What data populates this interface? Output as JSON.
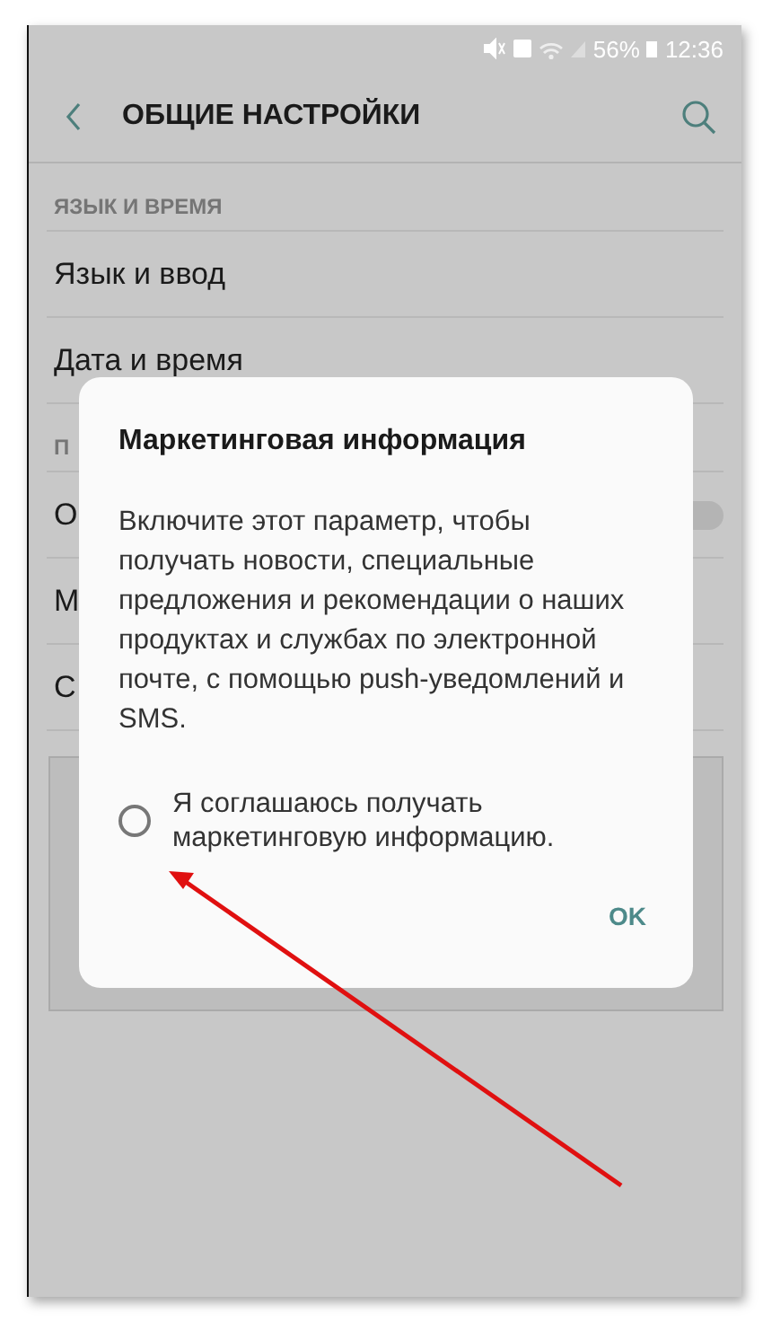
{
  "status_bar": {
    "battery": "56%",
    "time": "12:36"
  },
  "header": {
    "title": "ОБЩИЕ НАСТРОЙКИ"
  },
  "rows": [
    {
      "kind": "section",
      "text": "ЯЗЫК И ВРЕМЯ"
    },
    {
      "kind": "item",
      "text": "Язык и ввод"
    },
    {
      "kind": "item",
      "text": "Дата и время"
    },
    {
      "kind": "section",
      "text": "П"
    },
    {
      "kind": "toggle",
      "text": "О",
      "on": false
    },
    {
      "kind": "item",
      "text": "М"
    },
    {
      "kind": "item",
      "text": "С"
    }
  ],
  "dialog": {
    "title": "Маркетинговая информация",
    "body": "Включите этот параметр, чтобы получать новости, специальные предложения и рекомендации о наших продуктах и службах по электронной почте, с помощью push-уведомлений и SMS.",
    "option": {
      "label": "Я соглашаюсь получать маркетинговую информацию.",
      "selected": false
    },
    "button": "OK"
  }
}
